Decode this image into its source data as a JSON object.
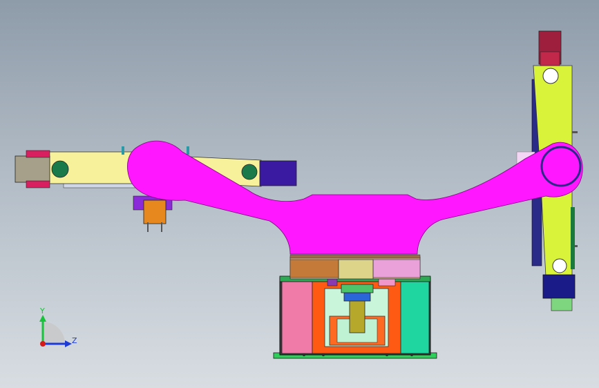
{
  "triad": {
    "y_label": "Y",
    "z_label": "Z",
    "colors": {
      "y_axis": "#18c23a",
      "z_axis": "#1d3ad6",
      "origin": "#d61a1a"
    }
  },
  "colors": {
    "background_top": "#8e9ba9",
    "background_bottom": "#d8dde2",
    "main_arm": "#ff17ff",
    "left_arm": "#f6f19a",
    "right_arm": "#d9f23a",
    "base_left_panel": "#f07aa8",
    "base_right_panel": "#1fd6a0",
    "base_center": "#ff5a14",
    "base_floor": "#2ecf5a"
  }
}
